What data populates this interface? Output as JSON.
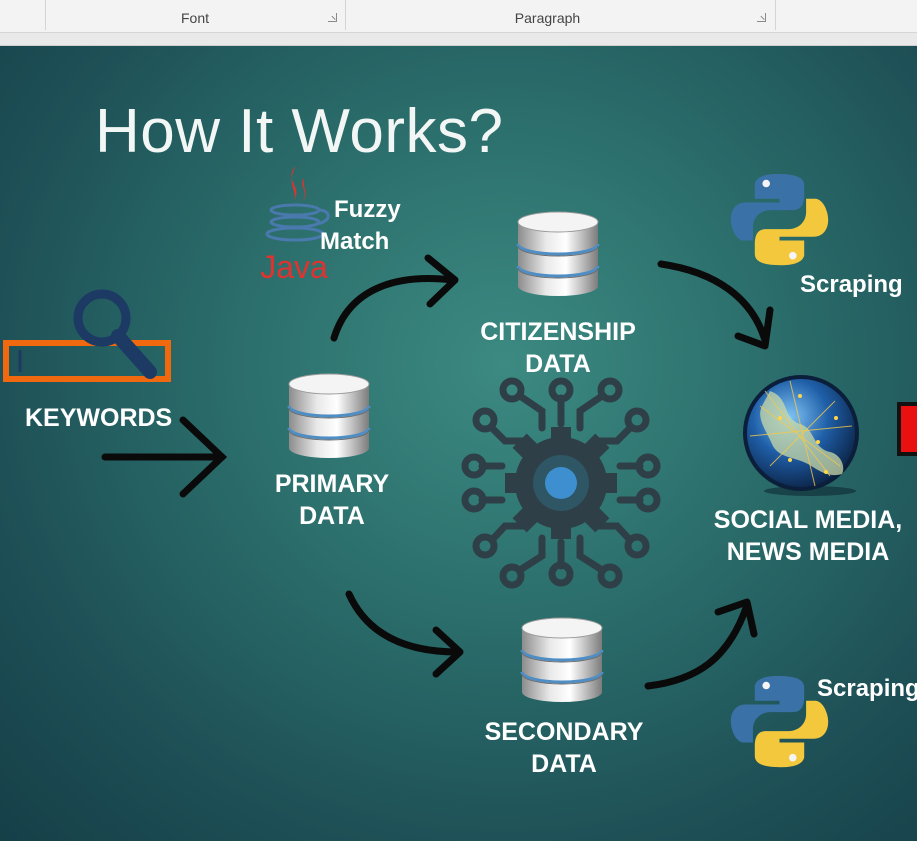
{
  "ribbon": {
    "groups": [
      {
        "label": "Font"
      },
      {
        "label": "Paragraph"
      }
    ]
  },
  "slide": {
    "title": "How It Works?",
    "keywords_label": "KEYWORDS",
    "fuzzy_match": [
      "Fuzzy",
      "Match"
    ],
    "java_text": "Java",
    "primary": [
      "PRIMARY",
      "DATA"
    ],
    "citizenship": [
      "CITIZENSHIP",
      "DATA"
    ],
    "secondary": [
      "SECONDARY",
      "DATA"
    ],
    "social": [
      "SOCIAL MEDIA,",
      "NEWS MEDIA"
    ],
    "scraping_top": "Scraping",
    "scraping_bottom": "Scraping",
    "colors": {
      "background": "#2a6c6a",
      "search_box": "#f0690f",
      "search_icon": "#1c3a63",
      "java_red": "#e0322f",
      "java_blue": "#4a79ad",
      "python_blue": "#3a72a8",
      "python_yellow": "#f3c83d",
      "gear": "#2f3f48",
      "gear_center": "#3d8fd0"
    }
  }
}
